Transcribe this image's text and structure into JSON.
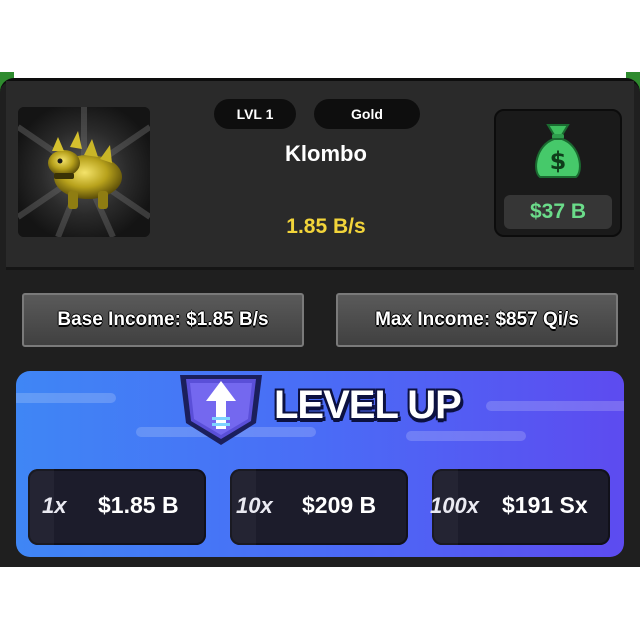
{
  "pet": {
    "level_label": "LVL 1",
    "rarity": "Gold",
    "name": "Klombo",
    "rate": "1.85 B/s",
    "icon": "golden-dinosaur-creature"
  },
  "wallet": {
    "value": "$37 B",
    "icon": "money-bag-icon"
  },
  "income": {
    "base": "Base Income: $1.85 B/s",
    "max": "Max Income: $857 Qi/s"
  },
  "level_up": {
    "title": "LEVEL UP",
    "icon": "up-arrow-emblem-icon",
    "options": [
      {
        "multiplier": "1x",
        "cost": "$1.85 B"
      },
      {
        "multiplier": "10x",
        "cost": "$209 B"
      },
      {
        "multiplier": "100x",
        "cost": "$191 Sx"
      }
    ]
  },
  "colors": {
    "rate_yellow": "#f2d43a",
    "money_green": "#6bdc8a",
    "panel_dark": "#1f1f1f",
    "levelup_blue": "#4a6cf6"
  }
}
